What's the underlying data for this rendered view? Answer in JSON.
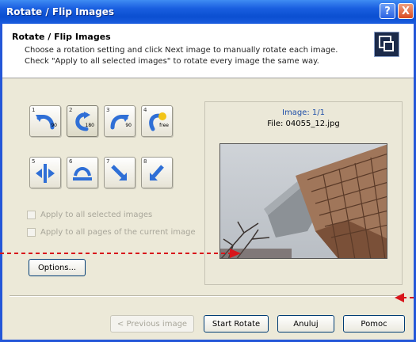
{
  "window": {
    "title": "Rotate / Flip Images",
    "help_button": "?",
    "close_button": "X"
  },
  "header": {
    "title": "Rotate / Flip Images",
    "line1": "Choose a rotation setting and click Next image to manually rotate each image.",
    "line2": "Check \"Apply to all selected images\" to rotate every image the same way."
  },
  "rotation_buttons": [
    {
      "num": "1",
      "label": "90",
      "icon": "rotate-left-90-icon"
    },
    {
      "num": "2",
      "label": "180",
      "icon": "rotate-180-icon"
    },
    {
      "num": "3",
      "label": "90",
      "icon": "rotate-right-90-icon"
    },
    {
      "num": "4",
      "label": "free",
      "icon": "rotate-free-icon"
    },
    {
      "num": "5",
      "label": "",
      "icon": "flip-horizontal-icon"
    },
    {
      "num": "6",
      "label": "",
      "icon": "flip-vertical-icon"
    },
    {
      "num": "7",
      "label": "",
      "icon": "flip-diagonal-icon"
    },
    {
      "num": "8",
      "label": "",
      "icon": "flip-antidiagonal-icon"
    }
  ],
  "options": {
    "apply_all_selected": "Apply to all selected images",
    "apply_all_pages": "Apply to all pages of the current image",
    "options_button": "Options..."
  },
  "preview": {
    "counter": "Image: 1/1",
    "file": "File: 04055_12.jpg"
  },
  "footer": {
    "previous": "< Previous image",
    "start": "Start Rotate",
    "cancel": "Anuluj",
    "help": "Pomoc"
  },
  "colors": {
    "titlebar": "#0b4fd1",
    "dialog_bg": "#ece9d8",
    "annotation_arrow": "#d8151b"
  }
}
